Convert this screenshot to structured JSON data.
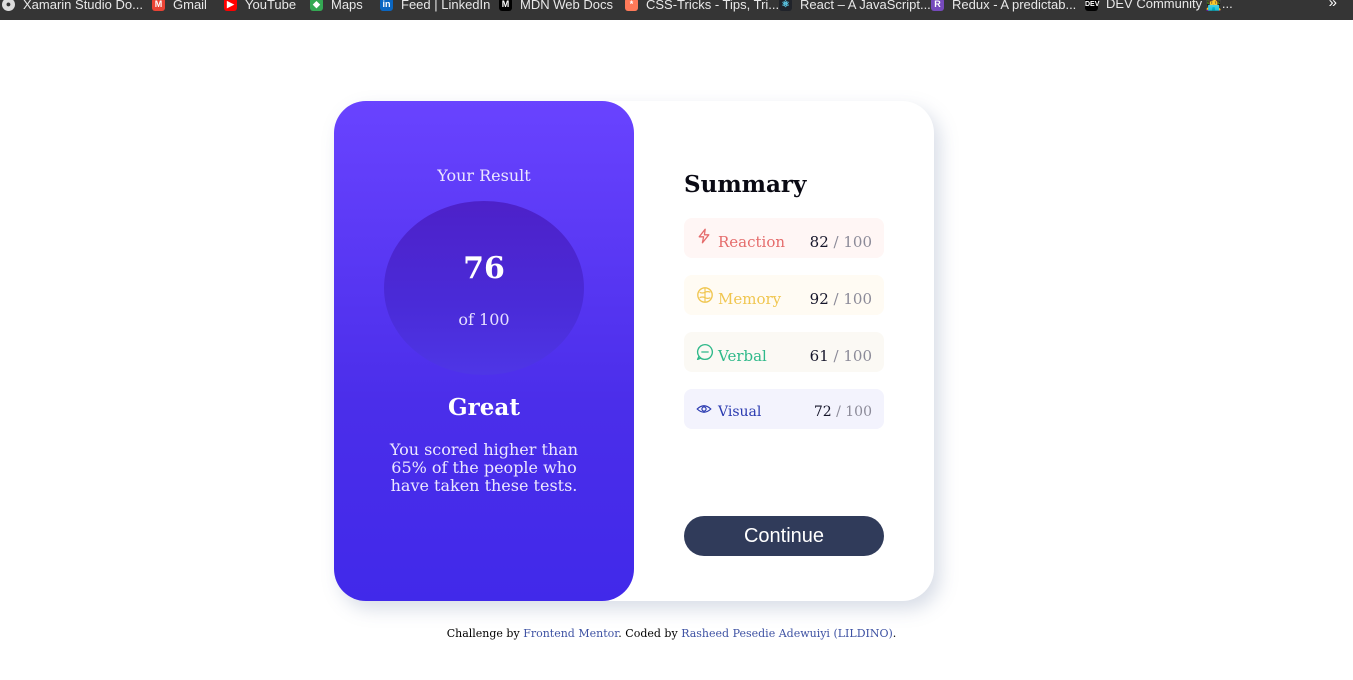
{
  "bookmarks": [
    {
      "label": "Xamarin Studio Do...",
      "icon": "globe-icon",
      "color": "#dddddd"
    },
    {
      "label": "Gmail",
      "icon": "gmail-icon",
      "color": "#ea4335"
    },
    {
      "label": "YouTube",
      "icon": "youtube-icon",
      "color": "#ff0000"
    },
    {
      "label": "Maps",
      "icon": "maps-icon",
      "color": "#34a853"
    },
    {
      "label": "Feed | LinkedIn",
      "icon": "linkedin-icon",
      "color": "#0a66c2"
    },
    {
      "label": "MDN Web Docs",
      "icon": "mdn-icon",
      "color": "#000000"
    },
    {
      "label": "CSS-Tricks - Tips, Tri...",
      "icon": "css-tricks-icon",
      "color": "#ff7a59"
    },
    {
      "label": "React – A JavaScript...",
      "icon": "react-icon",
      "color": "#61dafb"
    },
    {
      "label": "Redux - A predictab...",
      "icon": "redux-icon",
      "color": "#764abc"
    },
    {
      "label": "DEV Community 👩‍💻...",
      "icon": "dev-icon",
      "color": "#000000"
    }
  ],
  "bookmarks_more": "»",
  "result": {
    "title": "Your Result",
    "score": "76",
    "of": "of 100",
    "rating": "Great",
    "description": "You scored higher than 65% of the people who have taken these tests."
  },
  "summary": {
    "heading": "Summary",
    "items": [
      {
        "label": "Reaction",
        "score": "82",
        "total": "/ 100",
        "icon": "lightning-icon",
        "color": "#e56c6c",
        "bg": "#fff6f5"
      },
      {
        "label": "Memory",
        "score": "92",
        "total": "/ 100",
        "icon": "brain-icon",
        "color": "#f0c650",
        "bg": "#fffbf3"
      },
      {
        "label": "Verbal",
        "score": "61",
        "total": "/ 100",
        "icon": "chat-icon",
        "color": "#2fb98a",
        "bg": "#fbf9f4"
      },
      {
        "label": "Visual",
        "score": "72",
        "total": "/ 100",
        "icon": "eye-icon",
        "color": "#2a3ab0",
        "bg": "#f3f3fd"
      }
    ],
    "continue_label": "Continue"
  },
  "attribution": {
    "prefix": "Challenge by",
    "link1": "Frontend Mentor",
    "middle": ". Coded by",
    "link2": "Rasheed Pesedie Adewuiyi (LILDINO)",
    "suffix": "."
  }
}
